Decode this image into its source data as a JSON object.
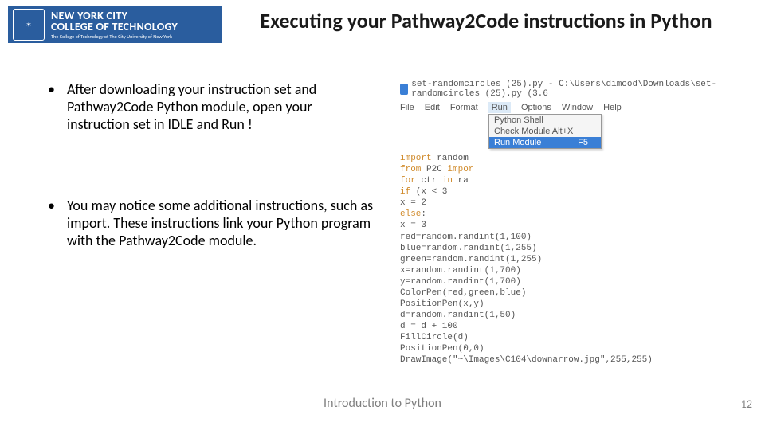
{
  "logo": {
    "line1": "NEW YORK CITY",
    "line2": "COLLEGE OF TECHNOLOGY",
    "line3": "The College of Technology of The City University of New York"
  },
  "title": "Executing your Pathway2Code instructions in Python",
  "bullets": [
    "After downloading your instruction set and Pathway2Code Python module, open your instruction set in IDLE and Run !",
    "You may  notice some additional instructions, such as import. These instructions link your Python program with the Pathway2Code module."
  ],
  "idle": {
    "window_title": "set-randomcircles (25).py - C:\\Users\\dimood\\Downloads\\set-randomcircles (25).py (3.6",
    "menu": {
      "file": "File",
      "edit": "Edit",
      "format": "Format",
      "run": "Run",
      "options": "Options",
      "window": "Window",
      "help": "Help"
    },
    "run_menu": {
      "shell": "Python Shell",
      "check": "Check Module   Alt+X",
      "runmod": "Run Module",
      "runkey": "F5"
    },
    "code": {
      "l1a": "import",
      "l1b": " random",
      "l2a": "from",
      "l2b": " P2C ",
      "l2c": "impor",
      "l3a": "for",
      "l3b": " ctr ",
      "l3c": "in",
      "l3d": " ra",
      "l4a": "    if",
      "l4b": " (x  <  3",
      "l5": "        x = 2",
      "l6a": "    else",
      "l6b": ":",
      "l7": "        x = 3",
      "l8": "    red=random.randint(1,100)",
      "l9": "    blue=random.randint(1,255)",
      "l10": "    green=random.randint(1,255)",
      "l11": "    x=random.randint(1,700)",
      "l12": "    y=random.randint(1,700)",
      "l13": "    ColorPen(red,green,blue)",
      "l14": "    PositionPen(x,y)",
      "l15": "    d=random.randint(1,50)",
      "l16": "    d = d + 100",
      "l17": "    FillCircle(d)",
      "l18": "PositionPen(0,0)",
      "l19": "DrawImage(\"~\\Images\\C104\\downarrow.jpg\",255,255)"
    }
  },
  "footer": "Introduction to Python",
  "page_number": "12"
}
